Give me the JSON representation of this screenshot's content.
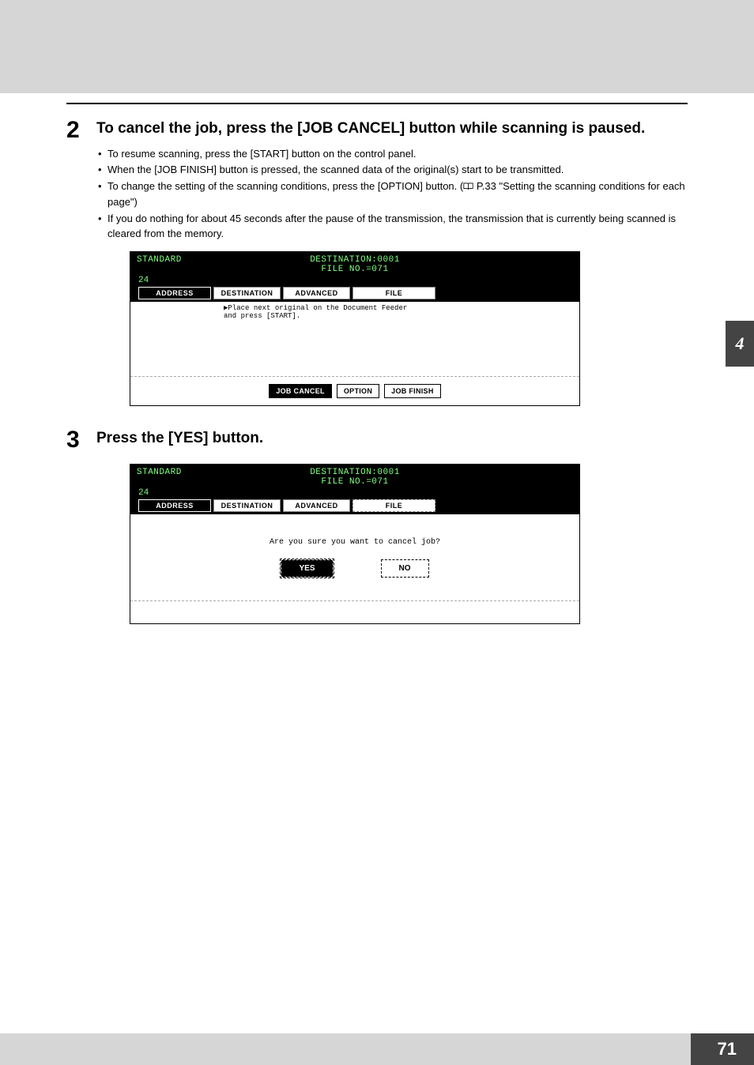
{
  "side_tab": "4",
  "page_number": "71",
  "step2": {
    "num": "2",
    "title": "To cancel the job, press the [JOB CANCEL] button while scanning is paused.",
    "bullets": [
      "To resume scanning, press the [START] button on the control panel.",
      "When the [JOB FINISH] button is pressed, the scanned data of the original(s) start to be transmitted."
    ],
    "bullet3_prefix": "To change the setting of the scanning conditions, press the [OPTION] button. (",
    "bullet3_ref": " P.33 \"Setting the scanning conditions for each page\")",
    "bullet4": "If you do nothing for about 45 seconds after the pause of the transmission, the transmission that is currently being scanned is cleared from the memory."
  },
  "step3": {
    "num": "3",
    "title": "Press the [YES] button."
  },
  "screen1": {
    "mode": "STANDARD",
    "dest": "DESTINATION:0001",
    "file": "FILE NO.=071",
    "counter": "24",
    "tabs": {
      "address": "ADDRESS",
      "destination": "DESTINATION",
      "advanced": "ADVANCED",
      "file": "FILE"
    },
    "instr_line1": "▶Place next original on the Document Feeder",
    "instr_line2": "  and press [START].",
    "btn_cancel": "JOB CANCEL",
    "btn_option": "OPTION",
    "btn_finish": "JOB FINISH"
  },
  "screen2": {
    "mode": "STANDARD",
    "dest": "DESTINATION:0001",
    "file": "FILE NO.=071",
    "counter": "24",
    "tabs": {
      "address": "ADDRESS",
      "destination": "DESTINATION",
      "advanced": "ADVANCED",
      "file": "FILE"
    },
    "confirm": "Are you sure you want to cancel job?",
    "yes": "YES",
    "no": "NO"
  }
}
